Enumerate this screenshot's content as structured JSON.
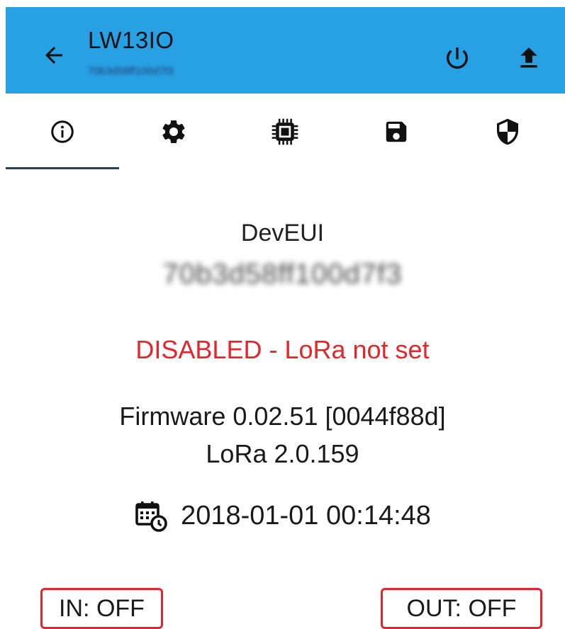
{
  "appbar": {
    "title": "LW13IO",
    "subtitle": "70b3d58ff100d7f3",
    "background": "#27a0e4"
  },
  "tabs": [
    {
      "icon": "info-icon",
      "active": true
    },
    {
      "icon": "gear-icon",
      "active": false
    },
    {
      "icon": "chip-icon",
      "active": false
    },
    {
      "icon": "save-icon",
      "active": false
    },
    {
      "icon": "shield-icon",
      "active": false
    }
  ],
  "device": {
    "deveui_label": "DevEUI",
    "deveui_value": "70b3d58ff100d7f3",
    "status": "DISABLED - LoRa not set",
    "status_color": "#e3262c",
    "firmware": "Firmware 0.02.51 [0044f88d]",
    "lora": "LoRa 2.0.159",
    "datetime": "2018-01-01 00:14:48"
  },
  "io": {
    "in_label": "IN: OFF",
    "out_label": "OUT: OFF"
  }
}
